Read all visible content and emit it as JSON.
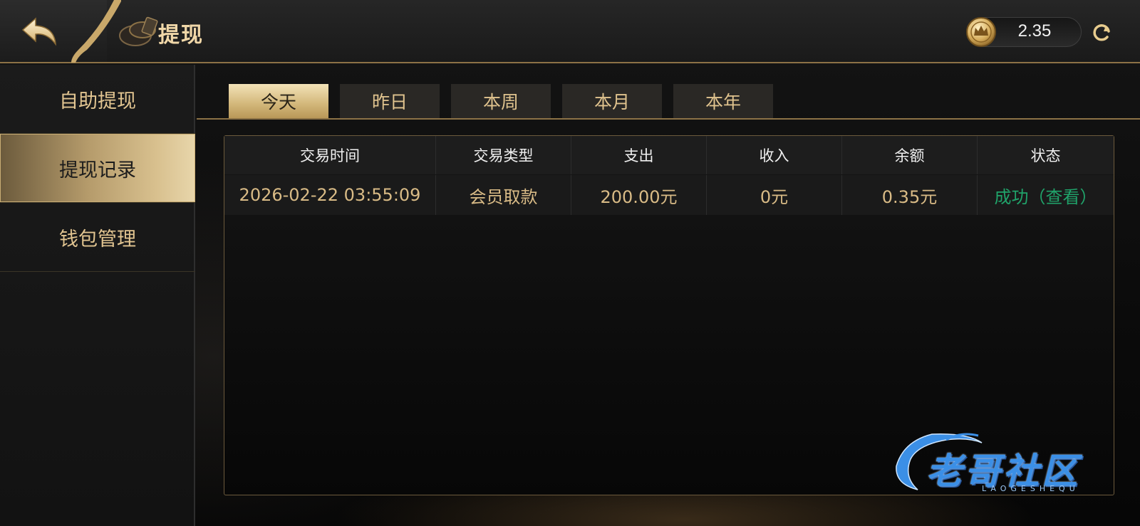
{
  "header": {
    "title": "提现",
    "balance": "2.35"
  },
  "sidebar": {
    "items": [
      {
        "label": "自助提现",
        "active": false
      },
      {
        "label": "提现记录",
        "active": true
      },
      {
        "label": "钱包管理",
        "active": false
      }
    ]
  },
  "tabs": [
    {
      "label": "今天",
      "active": true
    },
    {
      "label": "昨日",
      "active": false
    },
    {
      "label": "本周",
      "active": false
    },
    {
      "label": "本月",
      "active": false
    },
    {
      "label": "本年",
      "active": false
    }
  ],
  "table": {
    "columns": [
      "交易时间",
      "交易类型",
      "支出",
      "收入",
      "余额",
      "状态"
    ],
    "rows": [
      {
        "time": "2026-02-22 03:55:09",
        "type": "会员取款",
        "expense": "200.00元",
        "income": "0元",
        "balance": "0.35元",
        "status": "成功（查看）"
      }
    ]
  },
  "watermark": {
    "text": "老哥社区",
    "sub": "LAOGESHEQU"
  },
  "colors": {
    "gold": "#d9bb86",
    "gold_line": "#8c7246",
    "status_success": "#20a36a",
    "watermark_blue": "#3b8fe6"
  },
  "icons": [
    "back-arrow-icon",
    "poker-chips-icon",
    "crown-coin-icon",
    "refresh-icon",
    "dragon-icon"
  ]
}
